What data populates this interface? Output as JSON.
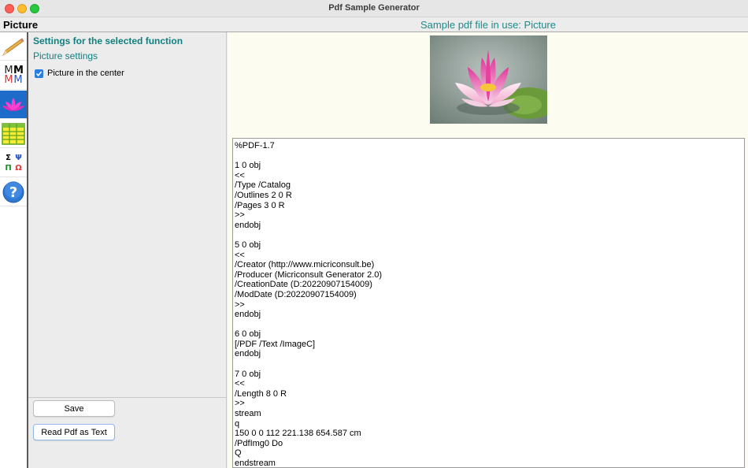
{
  "window": {
    "title": "Pdf Sample Generator"
  },
  "header": {
    "function_title": "Picture",
    "sample_title": "Sample pdf file in use: Picture"
  },
  "toolbar": {
    "mm_letters": [
      "M",
      "M",
      "M",
      "M"
    ],
    "greek_letters": [
      "Σ",
      "Ψ",
      "Π",
      "Ω"
    ],
    "help_glyph": "?",
    "active_color": "#1e6cc9"
  },
  "settings": {
    "title": "Settings for the selected function",
    "subtitle": "Picture settings",
    "checkbox_label": "Picture in the center",
    "checkbox_checked": true,
    "save_label": "Save",
    "read_label": "Read Pdf as Text"
  },
  "pdf_text": [
    "%PDF-1.7",
    "",
    "1 0 obj",
    "<<",
    "/Type /Catalog",
    "/Outlines 2 0 R",
    "/Pages 3 0 R",
    ">>",
    "endobj",
    "",
    "5 0 obj",
    "<<",
    "/Creator (http://www.micriconsult.be)",
    "/Producer (Micriconsult Generator 2.0)",
    "/CreationDate (D:20220907154009)",
    "/ModDate (D:20220907154009)",
    ">>",
    "endobj",
    "",
    "6 0 obj",
    "[/PDF /Text /ImageC]",
    "endobj",
    "",
    "7 0 obj",
    "<<",
    "/Length 8 0 R",
    ">>",
    "stream",
    "q",
    "150 0 0 112 221.138 654.587 cm",
    "/PdfImg0 Do",
    "Q",
    "endstream"
  ]
}
